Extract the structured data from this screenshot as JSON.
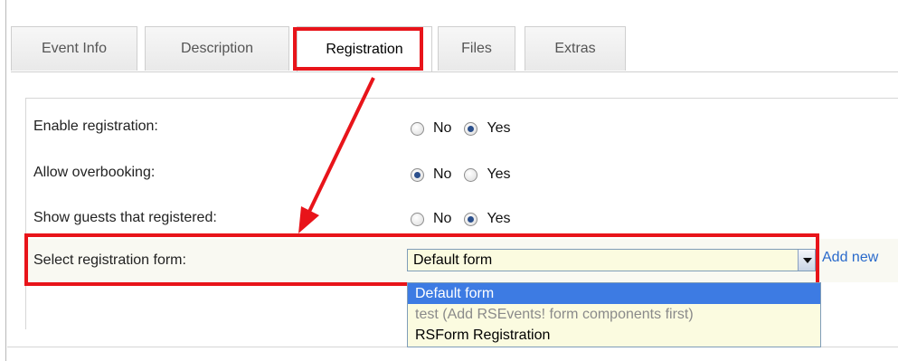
{
  "tabs": [
    {
      "label": "Event Info"
    },
    {
      "label": "Description"
    },
    {
      "label": "Registration"
    },
    {
      "label": "Files"
    },
    {
      "label": "Extras"
    }
  ],
  "active_tab": "Registration",
  "form": {
    "enable_registration": {
      "label": "Enable registration:",
      "value": "Yes"
    },
    "allow_overbooking": {
      "label": "Allow overbooking:",
      "value": "No"
    },
    "show_guests": {
      "label": "Show guests that registered:",
      "value": "Yes"
    },
    "radio_options": {
      "no": "No",
      "yes": "Yes"
    },
    "registration_form": {
      "label": "Select registration form:",
      "selected": "Default form",
      "add_new_label": "Add new",
      "options": [
        {
          "label": "Default form",
          "state": "selected"
        },
        {
          "label": "test (Add RSEvents! form components first)",
          "state": "disabled"
        },
        {
          "label": "RSForm Registration",
          "state": "normal"
        }
      ]
    }
  },
  "annotation_color": "#e8141a"
}
